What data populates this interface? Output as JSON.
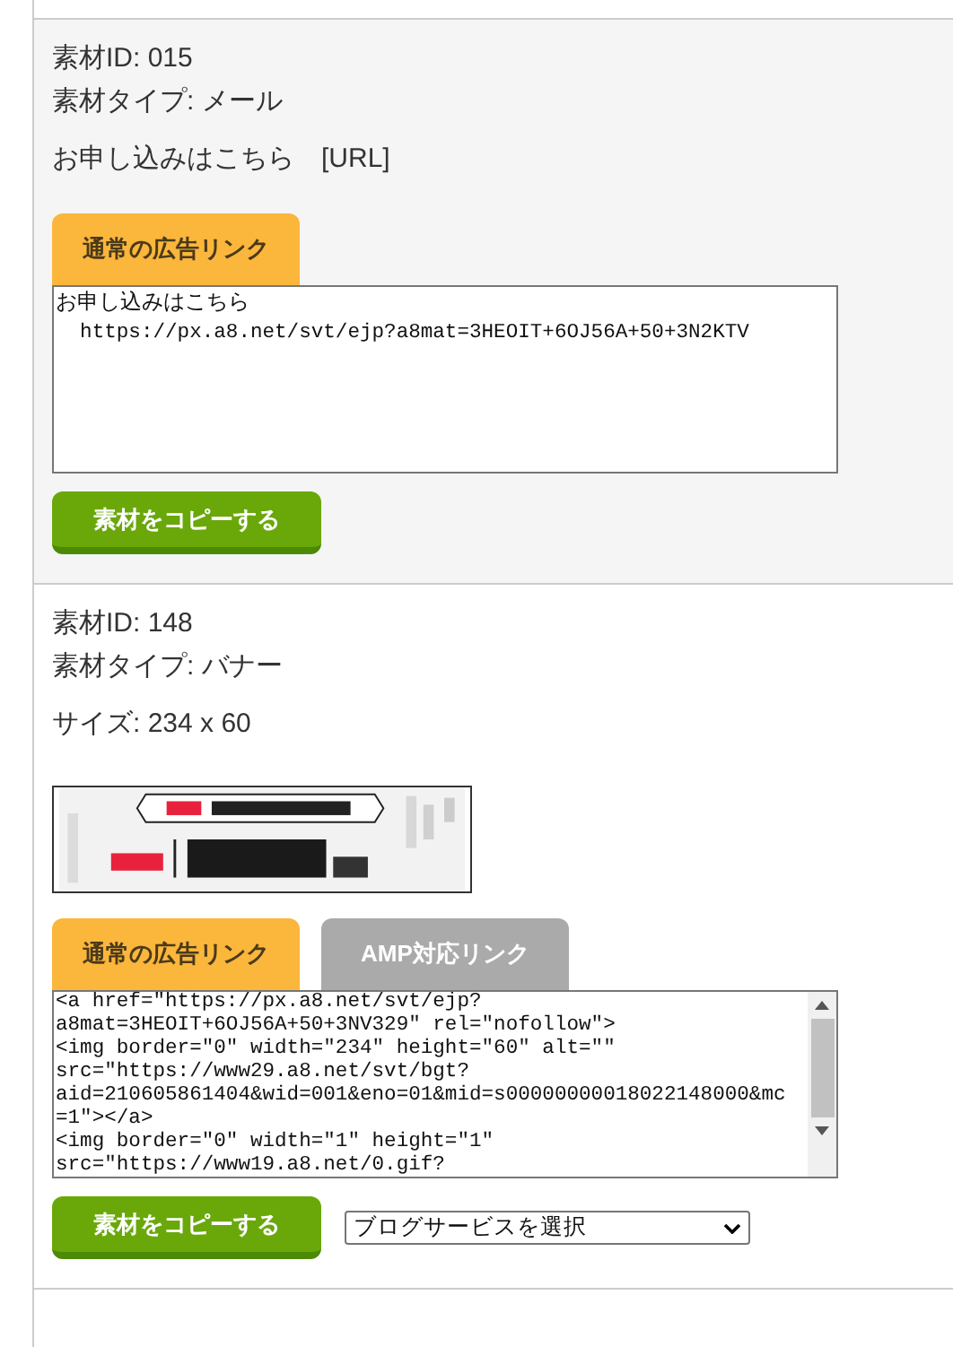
{
  "materials": [
    {
      "id_label": "素材ID: 015",
      "type_label": "素材タイプ: メール",
      "detail": "お申し込みはこちら　[URL]",
      "tabs": [
        {
          "label": "通常の広告リンク",
          "selected": true
        }
      ],
      "code_lines": [
        "お申し込みはこちら",
        "  https://px.a8.net/svt/ejp?a8mat=3HEOIT+6OJ56A+50+3N2KTV"
      ],
      "scrollbar": false,
      "copy_button": "素材をコピーする"
    },
    {
      "id_label": "素材ID: 148",
      "type_label": "素材タイプ: バナー",
      "detail": "サイズ: 234 x 60",
      "tabs": [
        {
          "label": "通常の広告リンク",
          "selected": true
        },
        {
          "label": "AMP対応リンク",
          "selected": false
        }
      ],
      "code_lines": [
        "<a href=\"https://px.a8.net/svt/ejp?",
        "a8mat=3HEOIT+6OJ56A+50+3NV329\" rel=\"nofollow\">",
        "<img border=\"0\" width=\"234\" height=\"60\" alt=\"\"",
        "src=\"https://www29.a8.net/svt/bgt?",
        "aid=210605861404&wid=001&eno=01&mid=s00000000018022148000&mc",
        "=1\"></a>",
        "<img border=\"0\" width=\"1\" height=\"1\"",
        "src=\"https://www19.a8.net/0.gif?"
      ],
      "scrollbar": true,
      "copy_button": "素材をコピーする",
      "blog_select": "ブログサービスを選択"
    }
  ]
}
